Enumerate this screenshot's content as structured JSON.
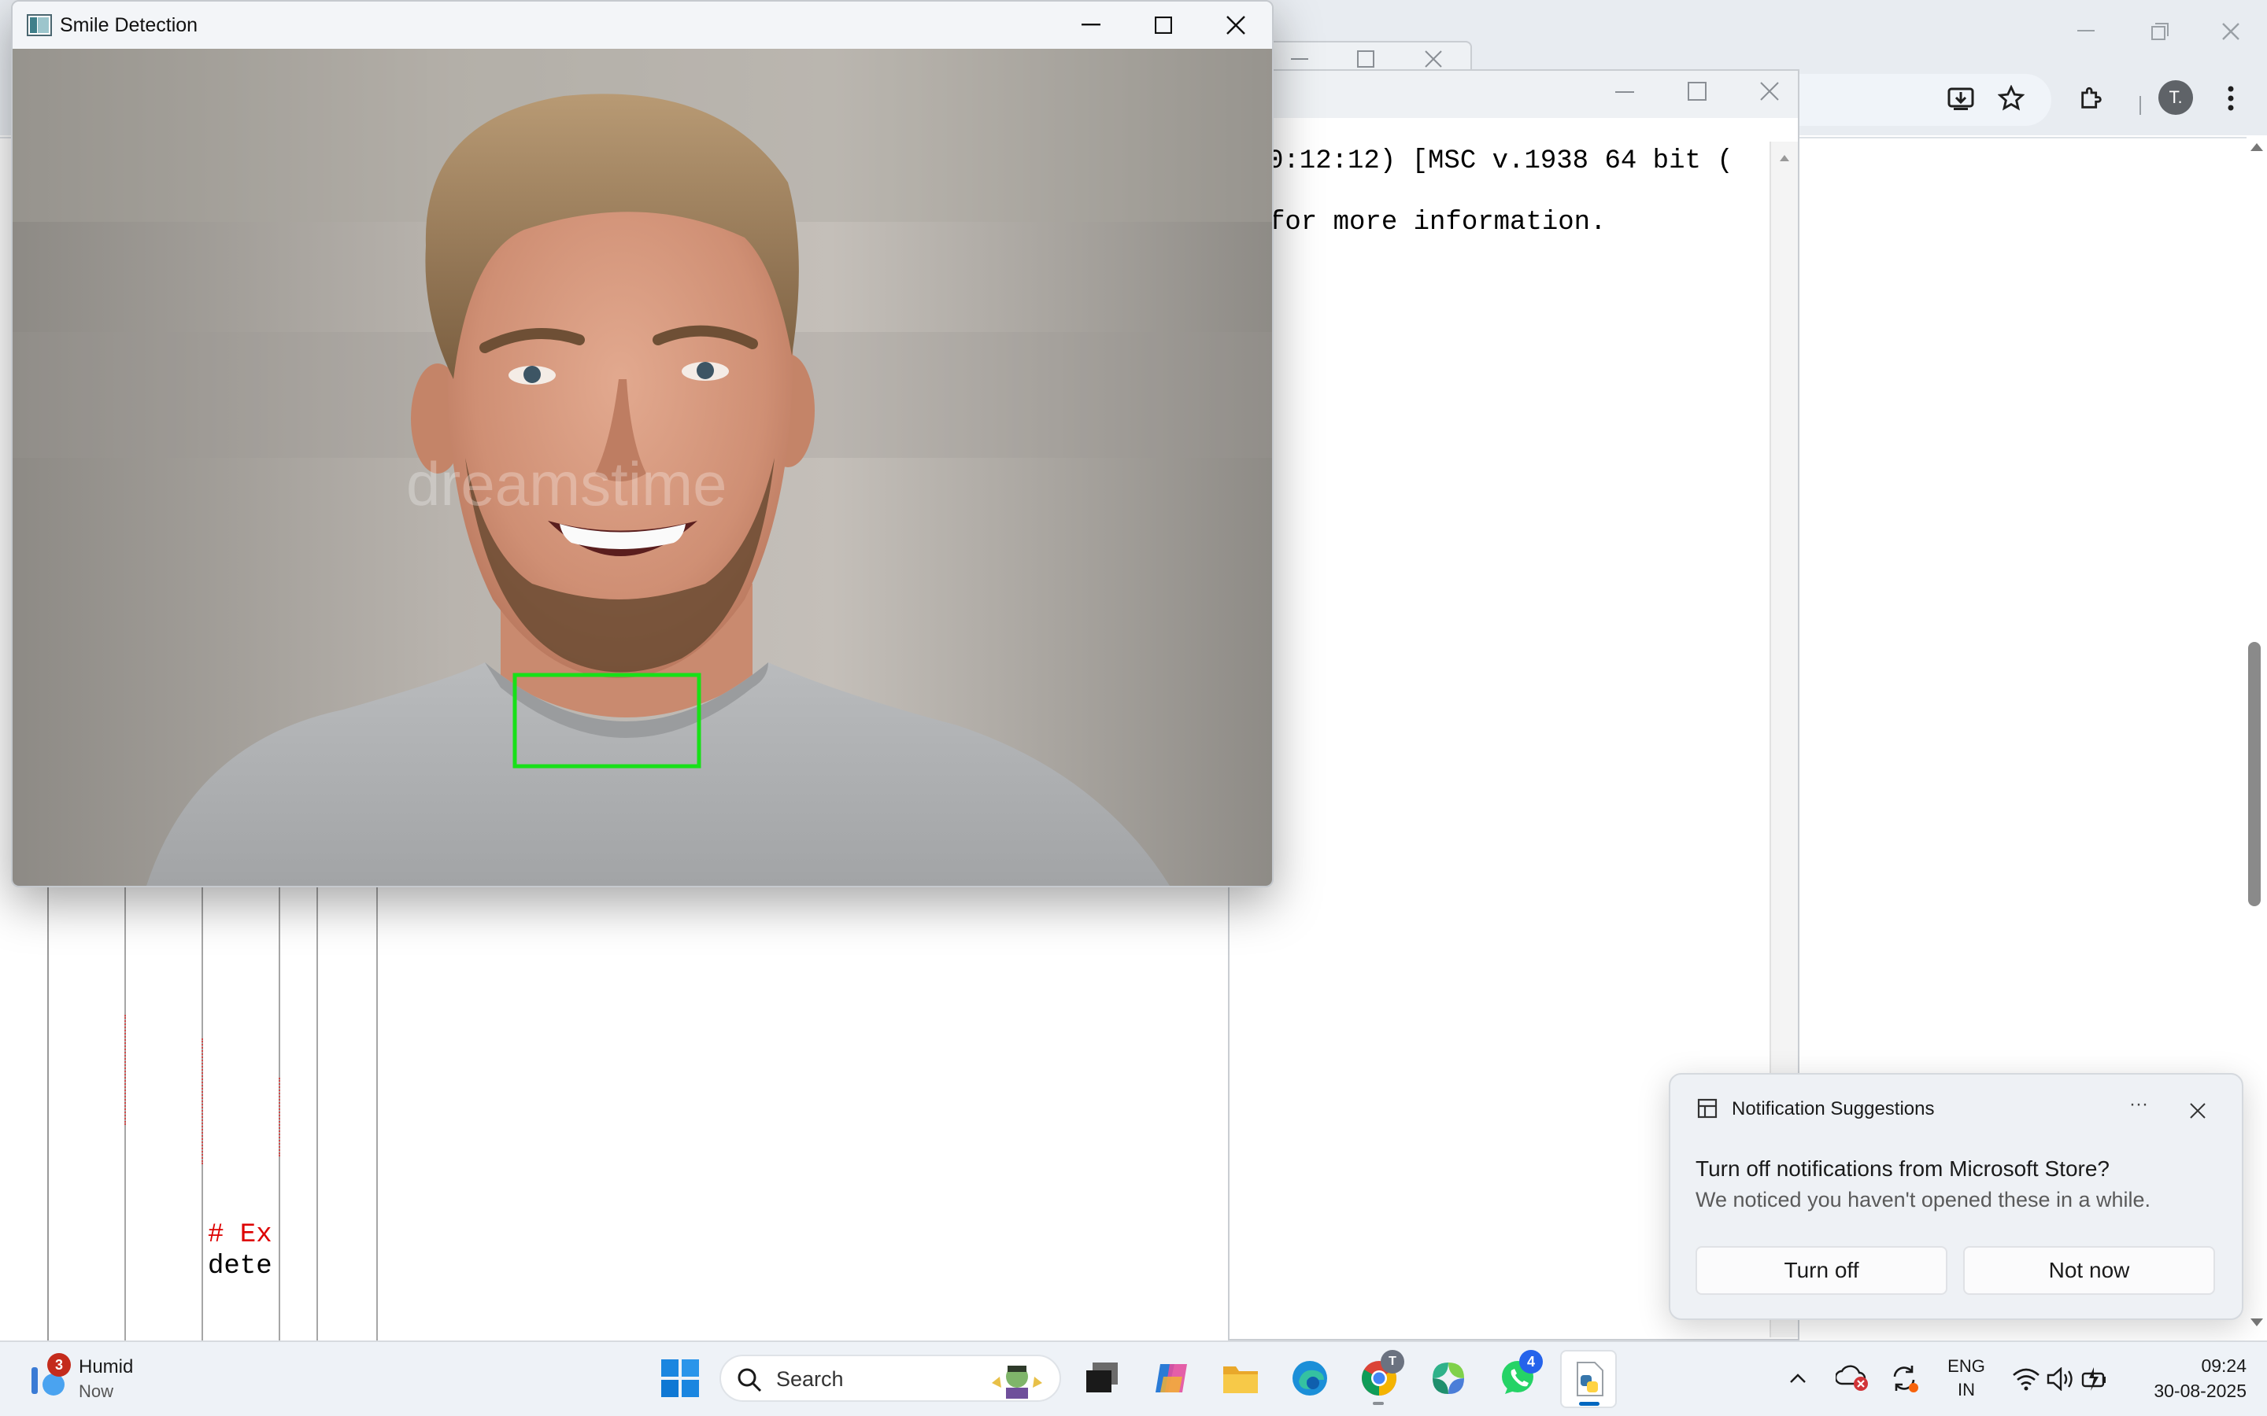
{
  "smile_window": {
    "title": "Smile Detection",
    "watermark": "dreamstime",
    "detection_box_color": "#18e018"
  },
  "python_shell": {
    "line1": "0:12:12) [MSC v.1938 64 bit (",
    "line2": "for more information."
  },
  "editor": {
    "comment": "# Ex",
    "code": "dete"
  },
  "notification": {
    "header": "Notification Suggestions",
    "more": "···",
    "title": "Turn off notifications from Microsoft Store?",
    "body": "We noticed you haven't opened these in a while.",
    "primary_button": "Turn off",
    "secondary_button": "Not now"
  },
  "chrome": {
    "profile_initial": "T."
  },
  "taskbar": {
    "weather_badge": "3",
    "weather_label": "Humid",
    "weather_time": "Now",
    "search_placeholder": "Search",
    "chrome_badge": "T",
    "whatsapp_badge": "4",
    "language_line1": "ENG",
    "language_line2": "IN",
    "time": "09:24",
    "date": "30-08-2025"
  },
  "colors": {
    "accent": "#0067c0",
    "detection_green": "#18e018",
    "badge_red": "#c42b1c"
  }
}
